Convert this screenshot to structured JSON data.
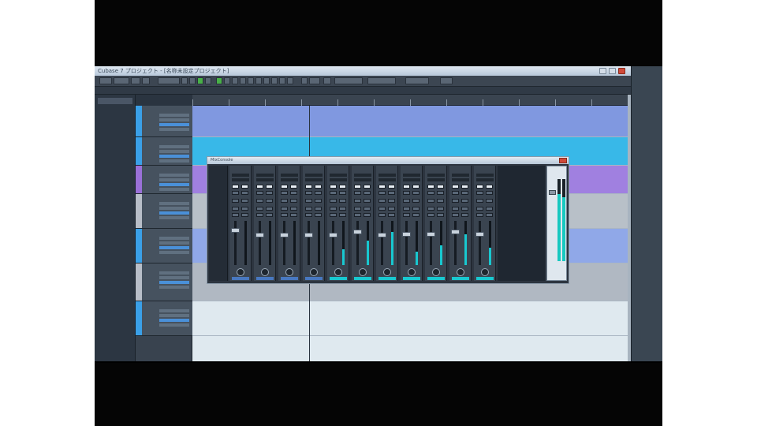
{
  "window": {
    "title": "Cubase 7 プロジェクト - [名称未設定プロジェクト]"
  },
  "mixer": {
    "title": "MixConsole",
    "channels": [
      {
        "level": 0.0,
        "color": "#4878c0"
      },
      {
        "level": 0.0,
        "color": "#4878c0"
      },
      {
        "level": 0.0,
        "color": "#4878c0"
      },
      {
        "level": 0.0,
        "color": "#4878c0"
      },
      {
        "level": 0.35,
        "color": "#18c8d0"
      },
      {
        "level": 0.55,
        "color": "#18c8d0"
      },
      {
        "level": 0.75,
        "color": "#18c8d0"
      },
      {
        "level": 0.3,
        "color": "#18c8d0"
      },
      {
        "level": 0.45,
        "color": "#18c8d0"
      },
      {
        "level": 0.7,
        "color": "#18c8d0"
      },
      {
        "level": 0.4,
        "color": "#18c8d0"
      }
    ],
    "master_level": 0.82
  },
  "tracks": [
    {
      "color": "#3aa0e8",
      "lane_color": "#8098e0"
    },
    {
      "color": "#3aa0e8",
      "lane_color": "#38b8e8"
    },
    {
      "color": "#9a70d8",
      "lane_color": "#a080e0"
    },
    {
      "color": "#b8bec8",
      "lane_color": "#b8c0c8"
    },
    {
      "color": "#3aa0e8",
      "lane_color": "#90a8e8"
    },
    {
      "color": "#b8bec8",
      "lane_color": "#b0b8c2"
    },
    {
      "color": "#3aa0e8",
      "lane_color": "#dfe9ef"
    }
  ]
}
